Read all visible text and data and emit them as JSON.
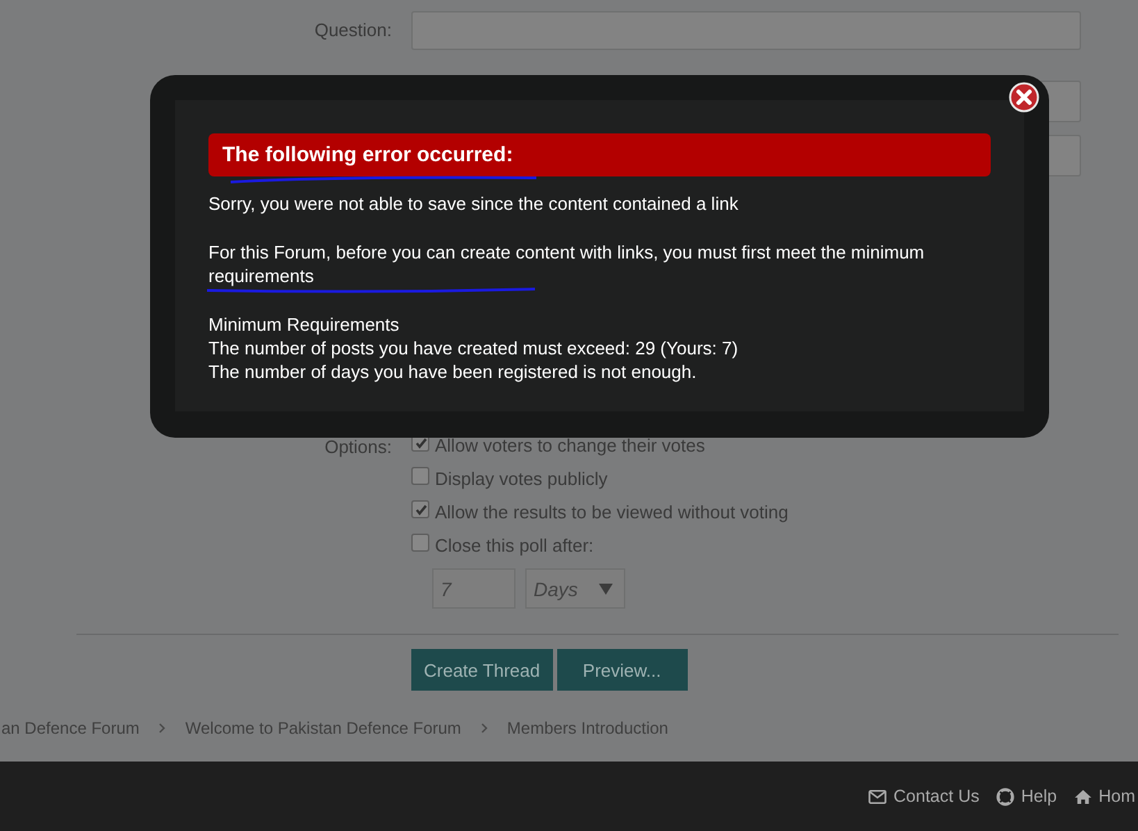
{
  "form": {
    "question_label": "Question:",
    "options_label": "Options:",
    "options": [
      {
        "label": "Allow voters to change their votes",
        "checked": true
      },
      {
        "label": "Display votes publicly",
        "checked": false
      },
      {
        "label": "Allow the results to be viewed without voting",
        "checked": true
      },
      {
        "label": "Close this poll after:",
        "checked": false
      }
    ],
    "close_after": {
      "value": "7",
      "unit": "Days"
    },
    "buttons": [
      "Create Thread",
      "Preview..."
    ]
  },
  "breadcrumb": [
    "an Defence Forum",
    "Welcome to Pakistan Defence Forum",
    "Members Introduction"
  ],
  "footer_links": [
    {
      "kind": "mail",
      "label": "Contact Us"
    },
    {
      "kind": "help",
      "label": "Help"
    },
    {
      "kind": "home",
      "label": "Hom"
    }
  ],
  "error_dialog": {
    "title": "The following error occurred:",
    "paragraphs": [
      [
        "Sorry, you were not able to save since the content contained a link"
      ],
      [
        "For this Forum, before you can create content with links, you must first meet the minimum requirements"
      ],
      [
        "Minimum Requirements",
        "The number of posts you have created must exceed: 29 (Yours: 7)",
        "The number of days you have been registered is not enough."
      ]
    ]
  }
}
